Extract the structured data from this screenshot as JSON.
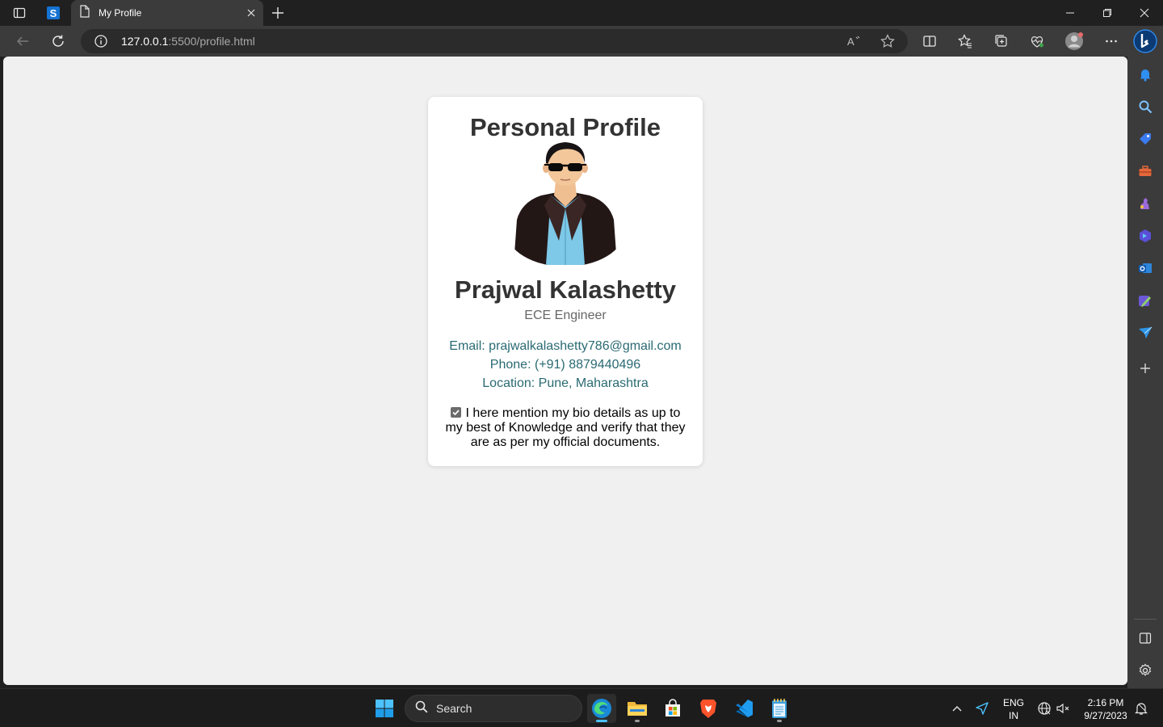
{
  "browser": {
    "tab_title": "My Profile",
    "url_host": "127.0.0.1",
    "url_rest": ":5500/profile.html"
  },
  "profile": {
    "heading": "Personal Profile",
    "name": "Prajwal Kalashetty",
    "role": "ECE Engineer",
    "email": "Email: prajwalkalashetty786@gmail.com",
    "phone": "Phone: (+91) 8879440496",
    "location": "Location: Pune, Maharashtra",
    "consent": "I here mention my bio details as up to my best of Knowledge and verify that they are as per my official documents.",
    "consent_checked": true
  },
  "taskbar": {
    "search_placeholder": "Search",
    "lang_line1": "ENG",
    "lang_line2": "IN",
    "time": "2:16 PM",
    "date": "9/27/2023"
  },
  "icons": {
    "sidebar": [
      "bell-icon",
      "search-icon",
      "shopping-tag-icon",
      "toolbox-icon",
      "games-icon",
      "copilot-icon",
      "outlook-icon",
      "designer-icon",
      "send-icon",
      "add-icon",
      "sidebar-toggle-icon",
      "settings-icon"
    ],
    "taskbar": [
      "windows-start-icon",
      "edge-icon",
      "file-explorer-icon",
      "microsoft-store-icon",
      "brave-icon",
      "vscode-icon",
      "notepad-icon"
    ]
  },
  "colors": {
    "contact_text": "#2a6a72",
    "heading_text": "#333333",
    "page_bg": "#f0f0f0"
  }
}
